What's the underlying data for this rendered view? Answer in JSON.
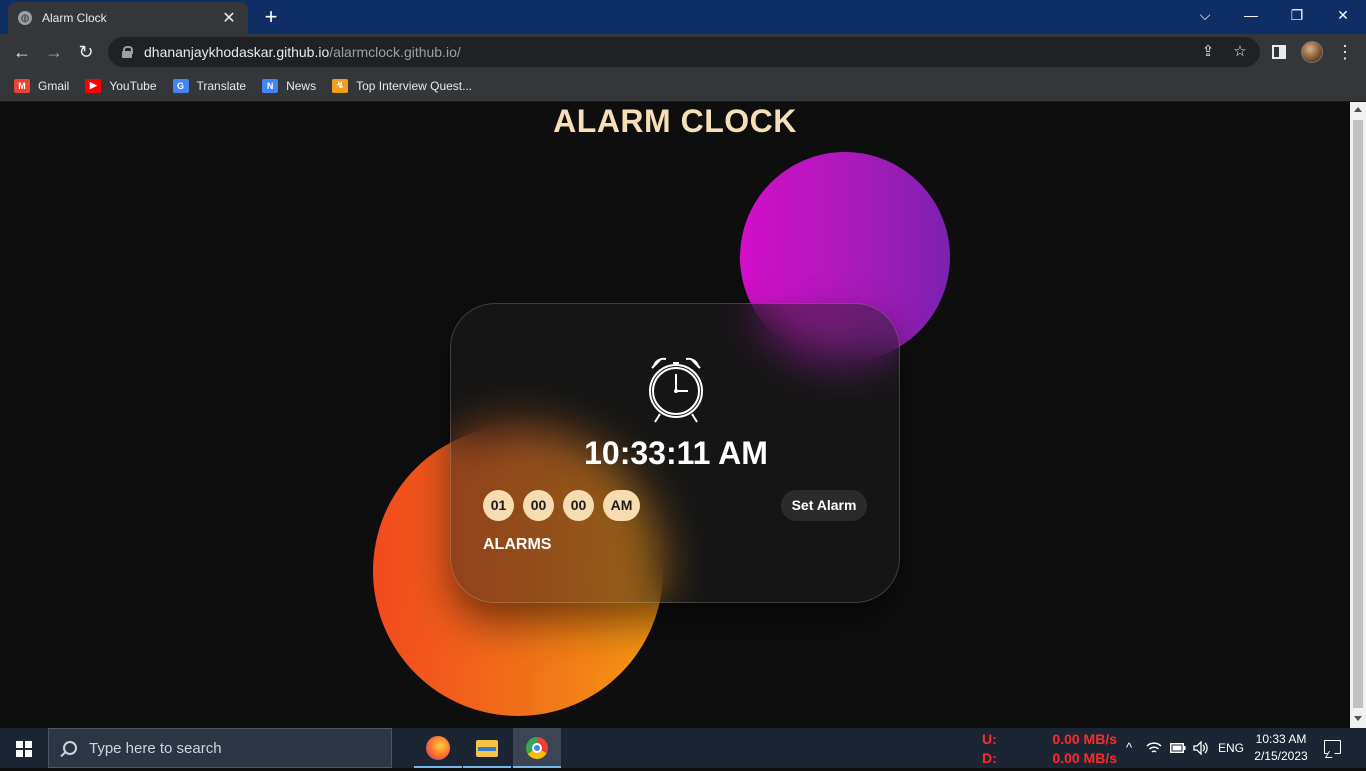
{
  "browser": {
    "tab_title": "Alarm Clock",
    "tab_close": "✕",
    "new_tab": "+",
    "url_host": "dhananjaykhodaskar.github.io",
    "url_path": "/alarmclock.github.io/",
    "window_controls": {
      "dropdown": "⌵",
      "minimize": "—",
      "restore": "❐",
      "close": "✕"
    },
    "nav": {
      "back": "←",
      "forward": "→",
      "reload": "↻"
    },
    "omni_icons": {
      "share": "⇪",
      "star": "☆"
    },
    "menu": "⋮"
  },
  "bookmarks": [
    {
      "label": "Gmail",
      "icon": "gmail-icon",
      "color": "#ea4335",
      "glyph": "M"
    },
    {
      "label": "YouTube",
      "icon": "youtube-icon",
      "color": "#ff0000",
      "glyph": "▶"
    },
    {
      "label": "Translate",
      "icon": "translate-icon",
      "color": "#4285f4",
      "glyph": "G"
    },
    {
      "label": "News",
      "icon": "news-icon",
      "color": "#4285f4",
      "glyph": "N"
    },
    {
      "label": "Top Interview Quest...",
      "icon": "leetcode-icon",
      "color": "#f0a01e",
      "glyph": "↯"
    }
  ],
  "app": {
    "title": "ALARM CLOCK",
    "current_time": "10:33:11 AM",
    "selectors": {
      "hour": "01",
      "minute": "00",
      "second": "00",
      "ampm": "AM"
    },
    "set_alarm_label": "Set Alarm",
    "alarms_heading": "ALARMS",
    "colors": {
      "title": "#f4dfb6",
      "selector_bg": "#f6dcb0",
      "purple": "#c016c4",
      "orange": "#f26a1a"
    }
  },
  "taskbar": {
    "search_placeholder": "Type here to search",
    "net": {
      "up_label": "U:",
      "up_value": "0.00 MB/s",
      "down_label": "D:",
      "down_value": "0.00 MB/s"
    },
    "tray_chevron": "^",
    "language": "ENG",
    "time": "10:33 AM",
    "date": "2/15/2023"
  }
}
